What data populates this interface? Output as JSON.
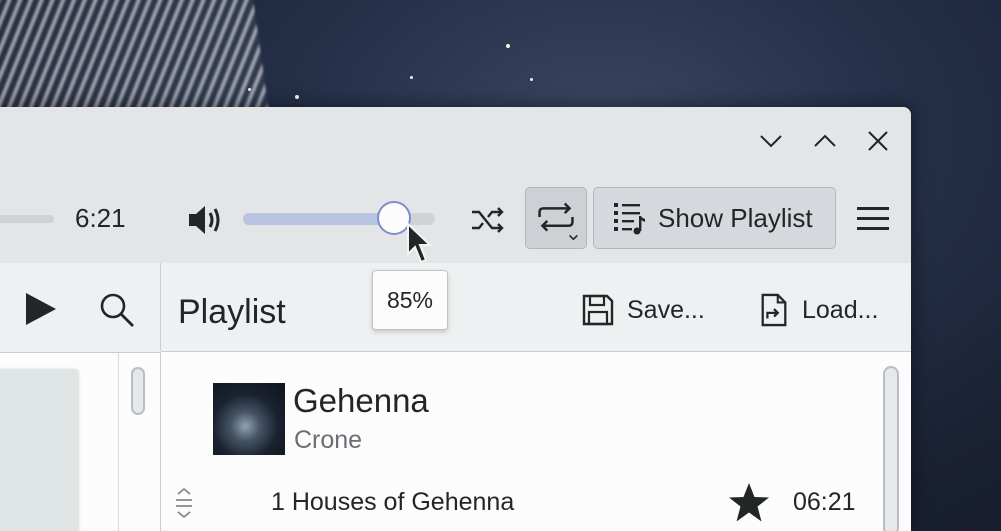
{
  "player": {
    "total_time": "6:21",
    "volume_percent": 85,
    "volume_tooltip": "85%",
    "show_playlist_label": "Show Playlist"
  },
  "playlist": {
    "title": "Playlist",
    "save_label": "Save...",
    "load_label": "Load...",
    "album": {
      "title": "Gehenna",
      "artist": "Crone"
    },
    "tracks": [
      {
        "number_title": "1 Houses of Gehenna",
        "duration": "06:21",
        "rated": true
      }
    ]
  },
  "colors": {
    "accent": "#7d8ec9",
    "accent_fill": "#b9c4e3",
    "text": "#232627",
    "window_bg": "#eff0f1"
  },
  "icons": [
    "minimize-icon",
    "maximize-icon",
    "close-icon",
    "volume-icon",
    "shuffle-icon",
    "repeat-icon",
    "playlist-icon",
    "hamburger-menu-icon",
    "play-icon",
    "search-icon",
    "save-icon",
    "load-icon",
    "drag-handle-icon",
    "star-icon"
  ]
}
